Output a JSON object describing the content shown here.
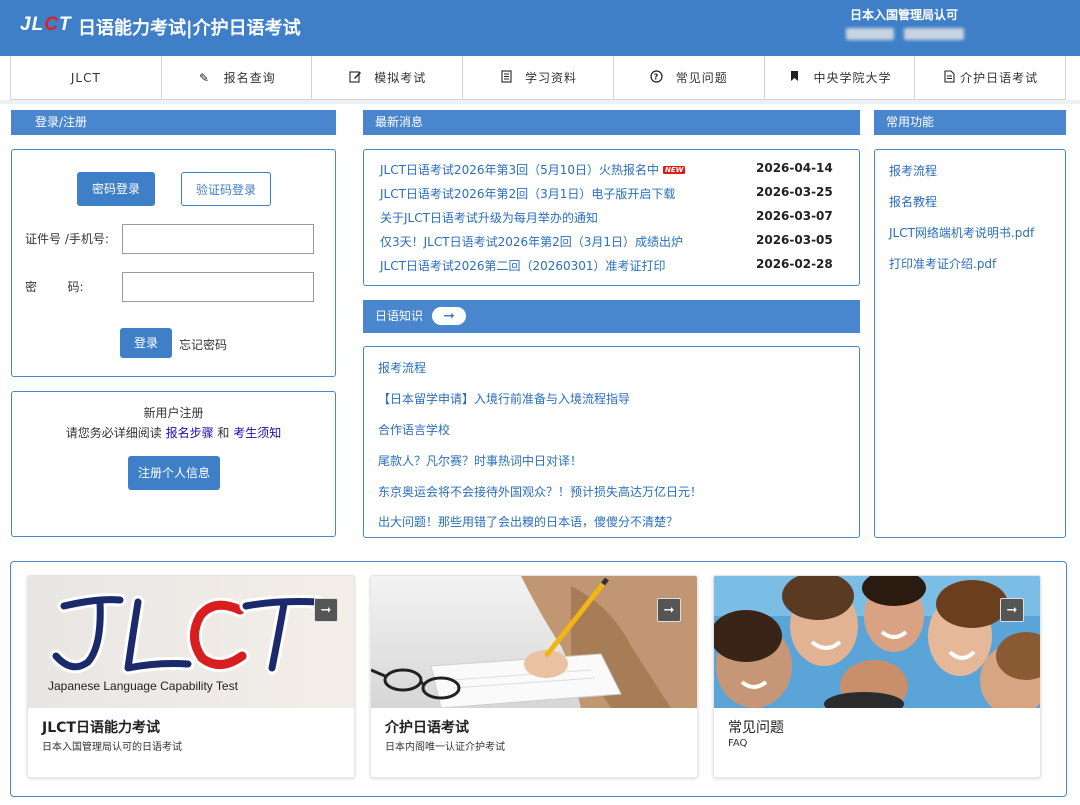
{
  "header": {
    "logo_prefix": "JL",
    "logo_c": "C",
    "logo_suffix": "T",
    "title": "日语能力考试|介护日语考试",
    "auth_note": "日本入国管理局认可"
  },
  "nav": {
    "items": [
      {
        "label": "JLCT",
        "icon": ""
      },
      {
        "label": "报名查询",
        "icon": "pencil-icon"
      },
      {
        "label": "模拟考试",
        "icon": "edit-icon"
      },
      {
        "label": "学习资料",
        "icon": "document-icon"
      },
      {
        "label": "常见问题",
        "icon": "question-icon"
      },
      {
        "label": "中央学院大学",
        "icon": "bookmark-icon"
      },
      {
        "label": "介护日语考试",
        "icon": "file-icon"
      }
    ]
  },
  "login": {
    "header": "登录/注册",
    "tab_password": "密码登录",
    "tab_code": "验证码登录",
    "id_label": "证件号 /手机号:",
    "pw_label": "密        码:",
    "id_value": "",
    "pw_value": "",
    "login_button": "登录",
    "forgot": "忘记密码"
  },
  "register": {
    "title": "新用户注册",
    "text_prefix": "请您务必详细阅读",
    "link_steps": "报名步骤",
    "and": "和",
    "link_notice": "考生须知",
    "button": "注册个人信息"
  },
  "news": {
    "header": "最新消息",
    "new_badge": "NEW",
    "items": [
      {
        "title": "JLCT日语考试2026年第3回（5月10日）火热报名中",
        "date": "2026-04-14"
      },
      {
        "title": "JLCT日语考试2026年第2回（3月1日）电子版开启下载",
        "date": "2026-03-25"
      },
      {
        "title": "关于JLCT日语考试升级为每月举办的通知",
        "date": "2026-03-07"
      },
      {
        "title": "仅3天！JLCT日语考试2026年第2回（3月1日）成绩出炉",
        "date": "2026-03-05"
      },
      {
        "title": "JLCT日语考试2026第二回（20260301）准考证打印",
        "date": "2026-02-28"
      }
    ]
  },
  "knowledge": {
    "header": "日语知识",
    "items": [
      "报考流程",
      "【日本留学申请】入境行前准备与入境流程指导",
      "合作语言学校",
      "尾款人？凡尔赛？时事热词中日对译！",
      "东京奥运会将不会接待外国观众？！预计损失高达万亿日元！",
      "出大问题！那些用错了会出糗的日本语，傻傻分不清楚？"
    ]
  },
  "functions": {
    "header": "常用功能",
    "items": [
      "报考流程",
      "报名教程",
      "JLCT网络端机考说明书.pdf",
      "打印准考证介绍.pdf"
    ]
  },
  "cards": [
    {
      "title": "JLCT日语能力考试",
      "subtitle": "日本入国管理局认可的日语考试",
      "image_caption": "Japanese Language Capability Test"
    },
    {
      "title": "介护日语考试",
      "subtitle": "日本内阁唯一认证介护考试"
    },
    {
      "title": "常见问题",
      "subtitle": "FAQ"
    }
  ],
  "colors": {
    "primary": "#3e7fc7",
    "panel_header": "#4a86cd",
    "link": "#2a6ebb",
    "badge": "#e01b1b"
  }
}
